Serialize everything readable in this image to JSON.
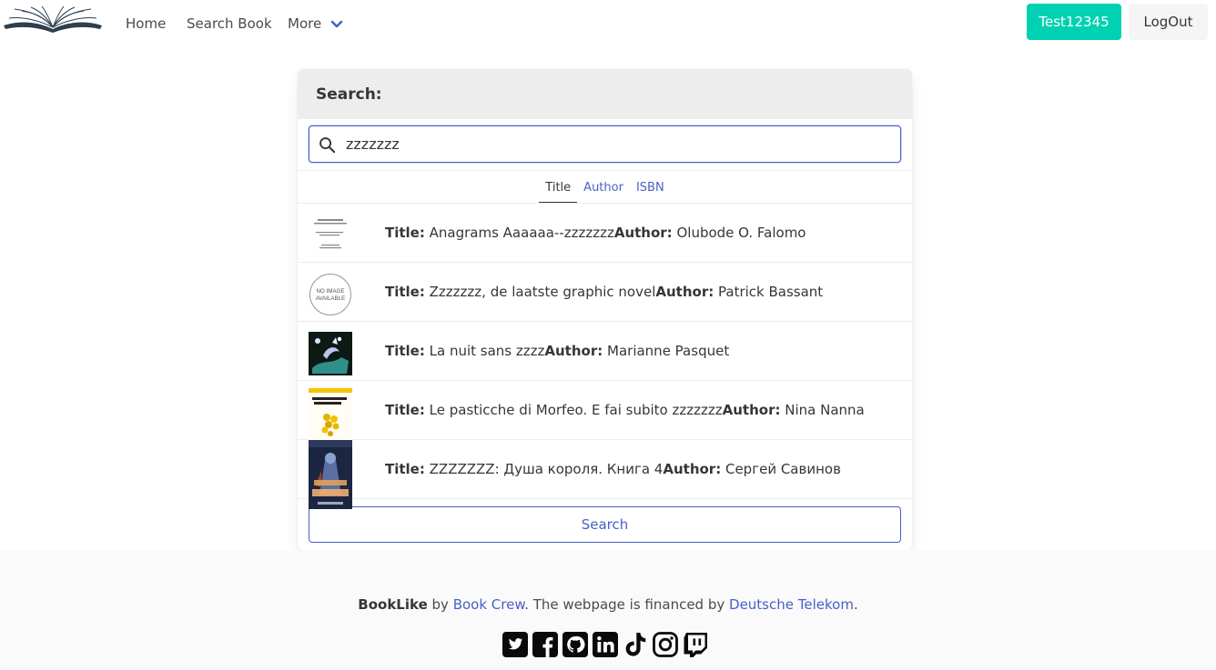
{
  "nav": {
    "logo_icon": "open-book-logo",
    "home": "Home",
    "search_book": "Search Book",
    "more": "More",
    "user_button": "Test12345",
    "logout_button": "LogOut"
  },
  "panel": {
    "heading": "Search:",
    "search_value": "zzzzzzz",
    "search_icon": "search-icon",
    "tabs": [
      {
        "label": "Title",
        "active": true
      },
      {
        "label": "Author",
        "active": false
      },
      {
        "label": "ISBN",
        "active": false
      }
    ],
    "title_label": "Title:",
    "author_label": "Author:",
    "results": [
      {
        "title": "Anagrams Aaaaaa--zzzzzzz",
        "author": "Olubode O. Falomo"
      },
      {
        "title": "Zzzzzzz, de laatste graphic novel",
        "author": "Patrick Bassant"
      },
      {
        "title": "La nuit sans zzzz",
        "author": "Marianne Pasquet"
      },
      {
        "title": "Le pasticche di Morfeo. E fai subito zzzzzzz",
        "author": "Nina Nanna"
      },
      {
        "title": "ZZZZZZZ: Душа короля. Книга 4",
        "author": "Сергей Савинов"
      }
    ],
    "no_image_text": [
      "NO IMAGE",
      "AVAILABLE"
    ],
    "search_button": "Search"
  },
  "footer": {
    "brand": "BookLike",
    "by": " by ",
    "crew": "Book Crew",
    "financed": ". The webpage is financed by ",
    "sponsor": "Deutsche Telekom",
    "end": ".",
    "socials": [
      "twitter-icon",
      "facebook-icon",
      "github-icon",
      "linkedin-icon",
      "tiktok-icon",
      "instagram-icon",
      "twitch-icon"
    ]
  },
  "colors": {
    "primary_teal": "#00d1b2",
    "link_blue": "#485fc7",
    "text_dark": "#363636",
    "panel_heading_bg": "#ededed",
    "footer_bg": "#fafafa"
  }
}
